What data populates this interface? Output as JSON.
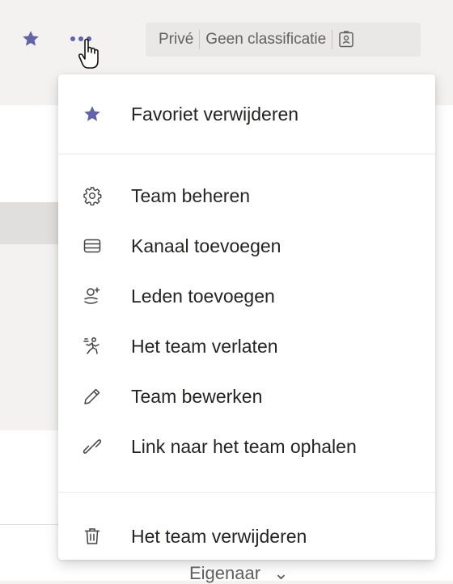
{
  "header": {
    "privacy": "Privé",
    "classification": "Geen classificatie"
  },
  "menu": {
    "favorite": "Favoriet verwijderen",
    "items": [
      {
        "label": "Team beheren",
        "icon": "gear-icon"
      },
      {
        "label": "Kanaal toevoegen",
        "icon": "channel-icon"
      },
      {
        "label": "Leden toevoegen",
        "icon": "add-person-icon"
      },
      {
        "label": "Het team verlaten",
        "icon": "leave-icon"
      },
      {
        "label": "Team bewerken",
        "icon": "pencil-icon"
      },
      {
        "label": "Link naar het team ophalen",
        "icon": "link-icon"
      }
    ],
    "delete": "Het team verwijderen"
  },
  "background": {
    "peek_text": "Eigenaar"
  },
  "colors": {
    "accent": "#6264a7",
    "text": "#252423",
    "muted": "#616161"
  }
}
